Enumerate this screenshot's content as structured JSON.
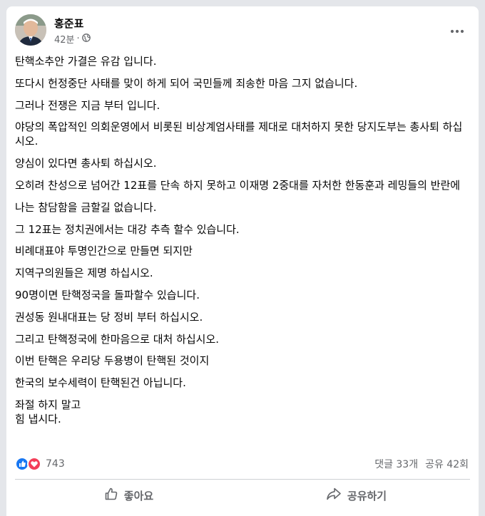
{
  "post": {
    "author": "홍준표",
    "time": "42분",
    "separator": "·",
    "lines": [
      "탄핵소추안 가결은 유감 입니다.",
      "또다시 헌정중단 사태를 맞이 하게 되어 국민들께 죄송한 마음 그지 없습니다.",
      "그러나 전쟁은 지금 부터 입니다.",
      "야당의 폭압적인 의회운영에서 비롯된 비상계엄사태를 제대로 대처하지 못한  당지도부는 총사퇴 하십시오.",
      "양심이 있다면 총사퇴 하십시오.",
      "오히려 찬성으로 넘어간 12표를 단속 하지 못하고 이재명 2중대를 자처한 한동훈과 레밍들의 반란에",
      "나는 참담함을 금할길 없습니다.",
      "그 12표는 정치권에서는 대강 추측 할수 있습니다.",
      "비례대표야 투명인간으로 만들면 되지만",
      "지역구의원들은 제명 하십시오.",
      "90명이면 탄핵정국을 돌파할수 있습니다.",
      "권성동 원내대표는 당 정비 부터 하십시오.",
      "그리고 탄핵정국에 한마음으로 대처 하십시오.",
      "이번 탄핵은 우리당 두용병이 탄핵된 것이지",
      "한국의 보수세력이 탄핵된건 아닙니다.",
      "좌절 하지 말고",
      "힘 냅시다."
    ]
  },
  "reactions": {
    "count": "743",
    "comments": "댓글 33개",
    "shares": "공유 42회",
    "colors": {
      "like": "#1877f2",
      "love": "#f33e58"
    }
  },
  "actions": {
    "like_label": "좋아요",
    "share_label": "공유하기"
  },
  "icons": {
    "audience": "globe-icon",
    "more": "more-options-icon",
    "like": "thumbs-up-icon",
    "share": "share-arrow-icon"
  }
}
